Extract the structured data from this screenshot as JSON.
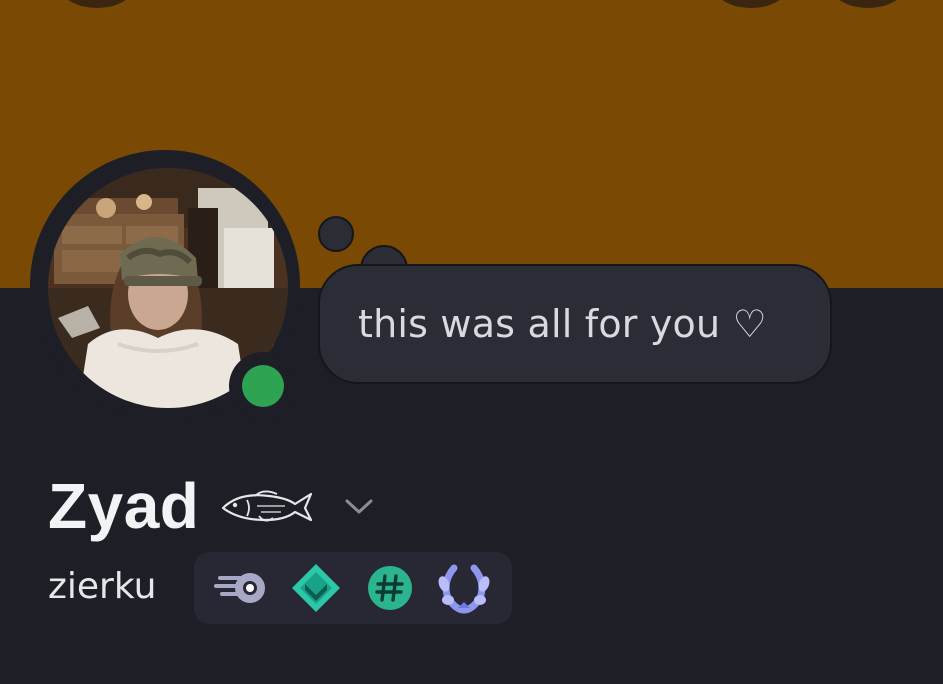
{
  "banner": {
    "color": "#7a4a04"
  },
  "profile": {
    "status": "online",
    "status_color": "#2ea352",
    "custom_status": "this was all for you ♡",
    "display_name": "Zyad",
    "display_name_icon": "fish-icon",
    "expand_icon": "chevron-down-icon",
    "username": "zierku"
  },
  "badges": [
    {
      "icon": "nitro-badge-icon"
    },
    {
      "icon": "boost-gem-badge-icon"
    },
    {
      "icon": "hashtag-badge-icon"
    },
    {
      "icon": "laurel-badge-icon"
    }
  ]
}
